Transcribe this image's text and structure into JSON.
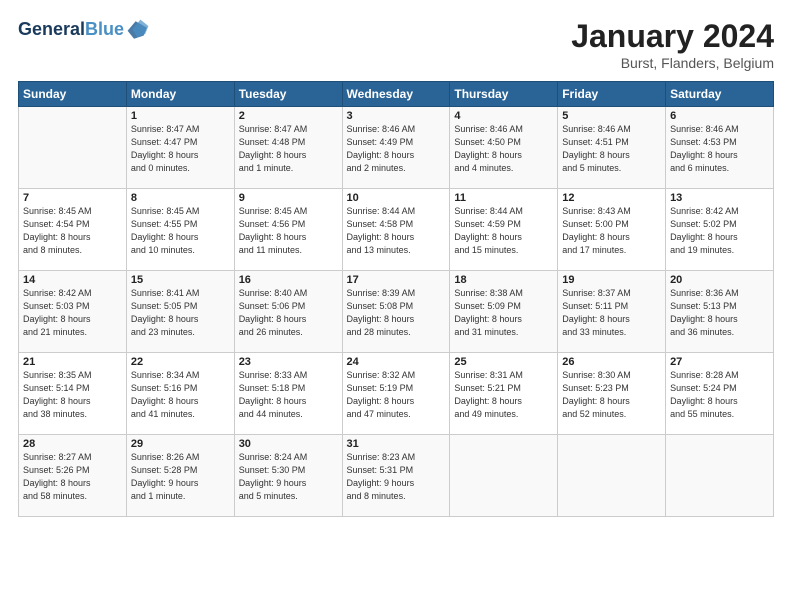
{
  "logo": {
    "line1": "General",
    "line2": "Blue"
  },
  "title": "January 2024",
  "subtitle": "Burst, Flanders, Belgium",
  "days_of_week": [
    "Sunday",
    "Monday",
    "Tuesday",
    "Wednesday",
    "Thursday",
    "Friday",
    "Saturday"
  ],
  "weeks": [
    [
      {
        "num": "",
        "info": ""
      },
      {
        "num": "1",
        "info": "Sunrise: 8:47 AM\nSunset: 4:47 PM\nDaylight: 8 hours\nand 0 minutes."
      },
      {
        "num": "2",
        "info": "Sunrise: 8:47 AM\nSunset: 4:48 PM\nDaylight: 8 hours\nand 1 minute."
      },
      {
        "num": "3",
        "info": "Sunrise: 8:46 AM\nSunset: 4:49 PM\nDaylight: 8 hours\nand 2 minutes."
      },
      {
        "num": "4",
        "info": "Sunrise: 8:46 AM\nSunset: 4:50 PM\nDaylight: 8 hours\nand 4 minutes."
      },
      {
        "num": "5",
        "info": "Sunrise: 8:46 AM\nSunset: 4:51 PM\nDaylight: 8 hours\nand 5 minutes."
      },
      {
        "num": "6",
        "info": "Sunrise: 8:46 AM\nSunset: 4:53 PM\nDaylight: 8 hours\nand 6 minutes."
      }
    ],
    [
      {
        "num": "7",
        "info": "Sunrise: 8:45 AM\nSunset: 4:54 PM\nDaylight: 8 hours\nand 8 minutes."
      },
      {
        "num": "8",
        "info": "Sunrise: 8:45 AM\nSunset: 4:55 PM\nDaylight: 8 hours\nand 10 minutes."
      },
      {
        "num": "9",
        "info": "Sunrise: 8:45 AM\nSunset: 4:56 PM\nDaylight: 8 hours\nand 11 minutes."
      },
      {
        "num": "10",
        "info": "Sunrise: 8:44 AM\nSunset: 4:58 PM\nDaylight: 8 hours\nand 13 minutes."
      },
      {
        "num": "11",
        "info": "Sunrise: 8:44 AM\nSunset: 4:59 PM\nDaylight: 8 hours\nand 15 minutes."
      },
      {
        "num": "12",
        "info": "Sunrise: 8:43 AM\nSunset: 5:00 PM\nDaylight: 8 hours\nand 17 minutes."
      },
      {
        "num": "13",
        "info": "Sunrise: 8:42 AM\nSunset: 5:02 PM\nDaylight: 8 hours\nand 19 minutes."
      }
    ],
    [
      {
        "num": "14",
        "info": "Sunrise: 8:42 AM\nSunset: 5:03 PM\nDaylight: 8 hours\nand 21 minutes."
      },
      {
        "num": "15",
        "info": "Sunrise: 8:41 AM\nSunset: 5:05 PM\nDaylight: 8 hours\nand 23 minutes."
      },
      {
        "num": "16",
        "info": "Sunrise: 8:40 AM\nSunset: 5:06 PM\nDaylight: 8 hours\nand 26 minutes."
      },
      {
        "num": "17",
        "info": "Sunrise: 8:39 AM\nSunset: 5:08 PM\nDaylight: 8 hours\nand 28 minutes."
      },
      {
        "num": "18",
        "info": "Sunrise: 8:38 AM\nSunset: 5:09 PM\nDaylight: 8 hours\nand 31 minutes."
      },
      {
        "num": "19",
        "info": "Sunrise: 8:37 AM\nSunset: 5:11 PM\nDaylight: 8 hours\nand 33 minutes."
      },
      {
        "num": "20",
        "info": "Sunrise: 8:36 AM\nSunset: 5:13 PM\nDaylight: 8 hours\nand 36 minutes."
      }
    ],
    [
      {
        "num": "21",
        "info": "Sunrise: 8:35 AM\nSunset: 5:14 PM\nDaylight: 8 hours\nand 38 minutes."
      },
      {
        "num": "22",
        "info": "Sunrise: 8:34 AM\nSunset: 5:16 PM\nDaylight: 8 hours\nand 41 minutes."
      },
      {
        "num": "23",
        "info": "Sunrise: 8:33 AM\nSunset: 5:18 PM\nDaylight: 8 hours\nand 44 minutes."
      },
      {
        "num": "24",
        "info": "Sunrise: 8:32 AM\nSunset: 5:19 PM\nDaylight: 8 hours\nand 47 minutes."
      },
      {
        "num": "25",
        "info": "Sunrise: 8:31 AM\nSunset: 5:21 PM\nDaylight: 8 hours\nand 49 minutes."
      },
      {
        "num": "26",
        "info": "Sunrise: 8:30 AM\nSunset: 5:23 PM\nDaylight: 8 hours\nand 52 minutes."
      },
      {
        "num": "27",
        "info": "Sunrise: 8:28 AM\nSunset: 5:24 PM\nDaylight: 8 hours\nand 55 minutes."
      }
    ],
    [
      {
        "num": "28",
        "info": "Sunrise: 8:27 AM\nSunset: 5:26 PM\nDaylight: 8 hours\nand 58 minutes."
      },
      {
        "num": "29",
        "info": "Sunrise: 8:26 AM\nSunset: 5:28 PM\nDaylight: 9 hours\nand 1 minute."
      },
      {
        "num": "30",
        "info": "Sunrise: 8:24 AM\nSunset: 5:30 PM\nDaylight: 9 hours\nand 5 minutes."
      },
      {
        "num": "31",
        "info": "Sunrise: 8:23 AM\nSunset: 5:31 PM\nDaylight: 9 hours\nand 8 minutes."
      },
      {
        "num": "",
        "info": ""
      },
      {
        "num": "",
        "info": ""
      },
      {
        "num": "",
        "info": ""
      }
    ]
  ]
}
